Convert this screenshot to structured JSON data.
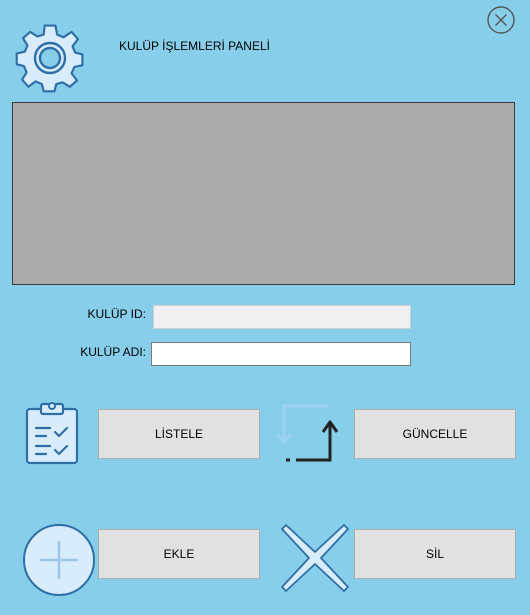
{
  "window": {
    "title": "KULÜP İŞLEMLERİ PANELİ"
  },
  "form": {
    "kulup_id_label": "KULÜP ID:",
    "kulup_id_value": "",
    "kulup_adi_label": "KULÜP ADI:",
    "kulup_adi_value": ""
  },
  "buttons": {
    "listele": "LİSTELE",
    "guncelle": "GÜNCELLE",
    "ekle": "EKLE",
    "sil": "SİL"
  },
  "icons": {
    "header": "gear-icon",
    "close": "close-icon",
    "listele": "clipboard-checklist-icon",
    "guncelle": "update-arrows-icon",
    "ekle": "plus-circle-icon",
    "sil": "x-icon"
  },
  "colors": {
    "background": "#87ceeb",
    "grid_background": "#ababab",
    "button_background": "#e1e1e1",
    "icon_fill": "#d8ecfb",
    "icon_stroke": "#2f6fa8"
  }
}
